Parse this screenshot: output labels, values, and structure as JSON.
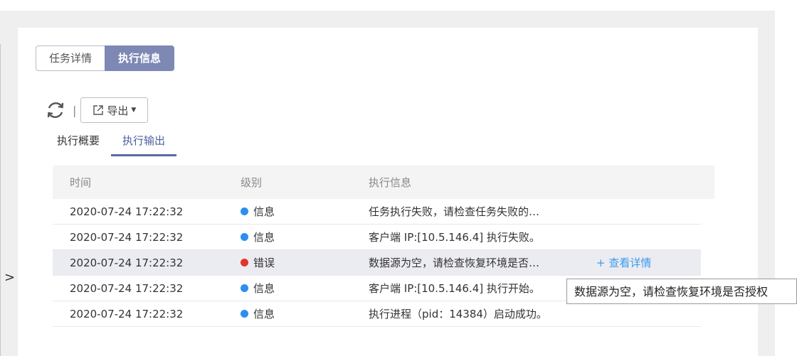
{
  "tabs": [
    {
      "label": "任务详情",
      "active": false
    },
    {
      "label": "执行信息",
      "active": true
    }
  ],
  "toolbar": {
    "separator": "|",
    "export_label": "导出"
  },
  "subtabs": [
    {
      "label": "执行概要",
      "active": false
    },
    {
      "label": "执行输出",
      "active": true
    }
  ],
  "table": {
    "headers": {
      "time": "时间",
      "level": "级别",
      "message": "执行信息"
    },
    "rows": [
      {
        "time": "2020-07-24 17:22:32",
        "level": "信息",
        "level_color": "#2b8ef0",
        "message": "任务执行失败，请检查任务失败的…",
        "action": ""
      },
      {
        "time": "2020-07-24 17:22:32",
        "level": "信息",
        "level_color": "#2b8ef0",
        "message": "客户端 IP:[10.5.146.4] 执行失败。",
        "action": ""
      },
      {
        "time": "2020-07-24 17:22:32",
        "level": "错误",
        "level_color": "#e2342b",
        "message": "数据源为空，请检查恢复环境是否…",
        "action": "+ 查看详情"
      },
      {
        "time": "2020-07-24 17:22:32",
        "level": "信息",
        "level_color": "#2b8ef0",
        "message": "客户端 IP:[10.5.146.4] 执行开始。",
        "action": ""
      },
      {
        "time": "2020-07-24 17:22:32",
        "level": "信息",
        "level_color": "#2b8ef0",
        "message": "执行进程（pid：14384）启动成功。",
        "action": ""
      }
    ]
  },
  "tooltip": "数据源为空，请检查恢复环境是否授权",
  "collapse_glyph": ">",
  "colors": {
    "accent": "#7d89b4",
    "info": "#2b8ef0",
    "error": "#e2342b",
    "link": "#3a9bea"
  }
}
